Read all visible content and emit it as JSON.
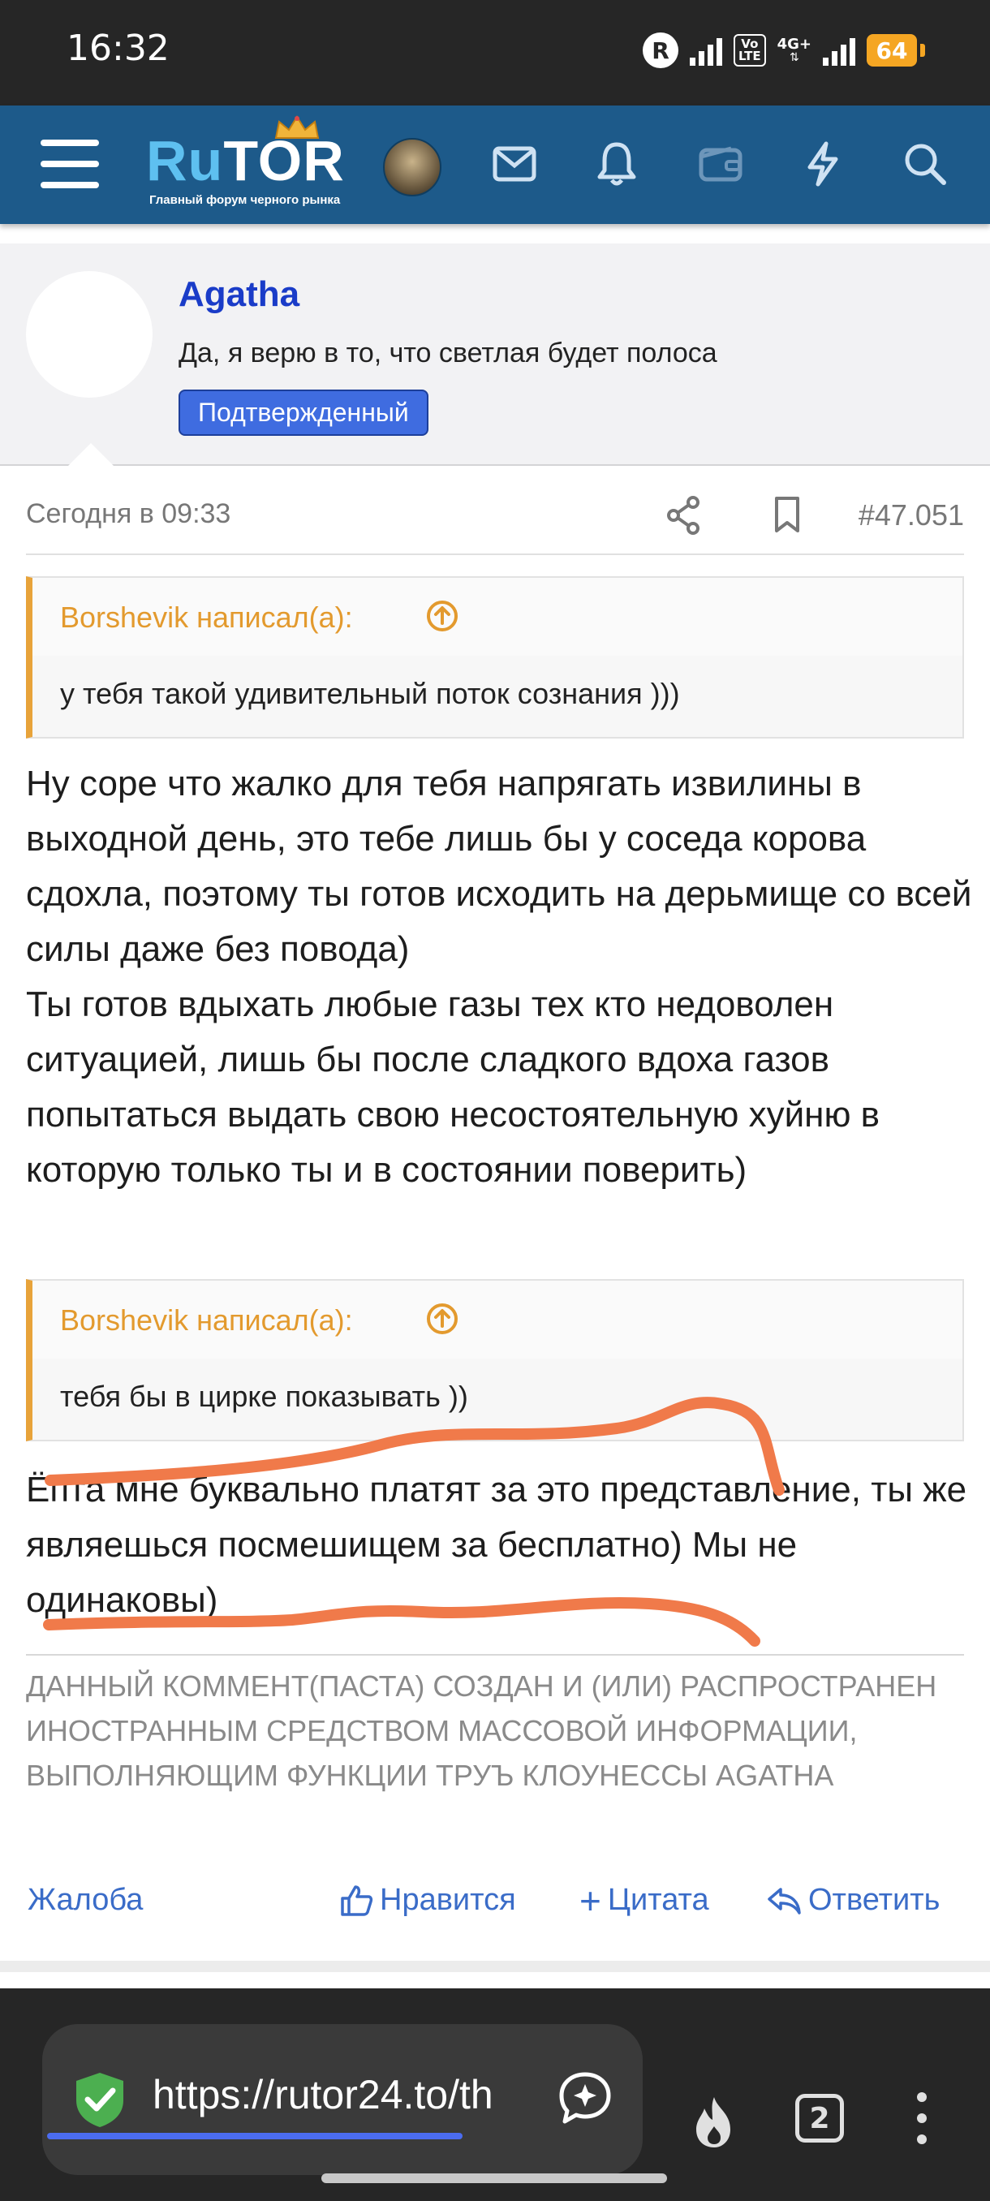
{
  "status_bar": {
    "time": "16:32",
    "r_badge": "R",
    "volte_label": "Vo\nLTE",
    "network": "4G+",
    "battery": "64"
  },
  "header": {
    "logo_ru": "Ru",
    "logo_tor": "TOR",
    "logo_subtitle": "Главный форум черного рынка",
    "icons": [
      "menu-icon",
      "mail-icon",
      "bell-icon",
      "wallet-icon",
      "lightning-icon",
      "search-icon"
    ]
  },
  "user": {
    "name": "Agatha",
    "title": "Да, я верю в то, что светлая будет полоса",
    "badge": "Подтвержденный"
  },
  "post": {
    "date": "Сегодня в 09:33",
    "number": "#47.051",
    "quote1": {
      "author": "Borshevik написал(а):",
      "text": "у тебя такой удивительный поток сознания )))"
    },
    "paragraph1": "Ну соре что жалко для тебя напрягать извилины в выходной день, это тебе лишь бы у соседа корова сдохла, поэтому ты готов исходить на дерьмище со всей силы даже без повода)\nТы готов вдыхать любые газы тех кто недоволен ситуацией, лишь бы после сладкого вдоха газов попытаться выдать свою несостоятельную хуйню в которую только ты и в состоянии поверить)",
    "quote2": {
      "author": "Borshevik написал(а):",
      "text": "тебя бы в цирке показывать ))"
    },
    "paragraph2": "Ёпта мне буквально платят за это представление, ты же являешься посмешищем за бесплатно) Мы не одинаковы)",
    "signature": "ДАННЫЙ КОММЕНТ(ПАСТА) СОЗДАН И (ИЛИ) РАСПРОСТРАНЕН ИНОСТРАННЫМ СРЕДСТВОМ МАССОВОЙ ИНФОРМАЦИИ, ВЫПОЛНЯЮЩИМ ФУНКЦИИ ТРУЪ КЛОУНЕССЫ AGATHA"
  },
  "actions": {
    "report": "Жалоба",
    "like": "Нравится",
    "quote": "Цитата",
    "reply": "Ответить"
  },
  "browser": {
    "url": "https://rutor24.to/th",
    "tab_count": "2"
  },
  "colors": {
    "header_bg": "#1d5a8a",
    "accent_link": "#3a6cc8",
    "quote_accent": "#e39a2e",
    "badge_bg": "#3f6ce0",
    "annotation": "#f07a4a"
  }
}
